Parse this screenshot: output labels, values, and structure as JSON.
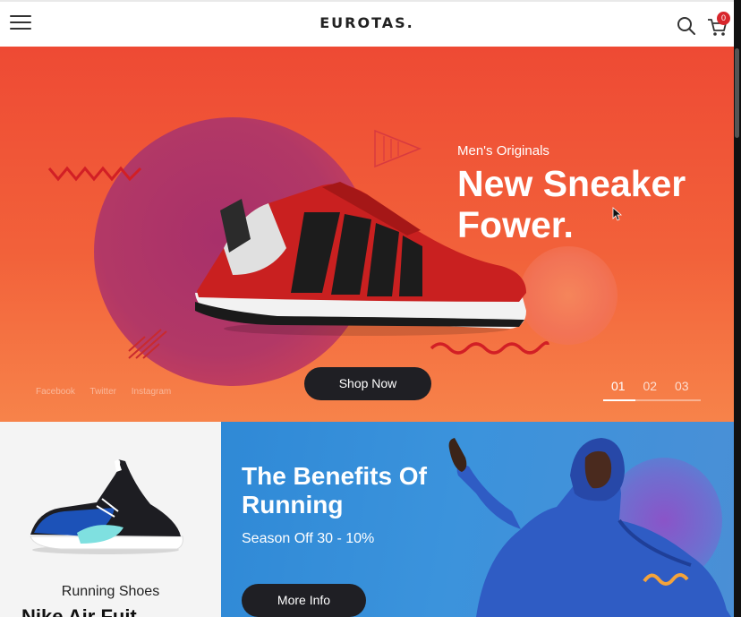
{
  "header": {
    "logo": "EUROTAS.",
    "cart_count": "0"
  },
  "hero": {
    "subtitle": "Men's Originals",
    "title": "New Sneaker Fower.",
    "shop_button": "Shop Now",
    "socials": [
      "Facebook",
      "Twitter",
      "Instagram"
    ],
    "slides": [
      "01",
      "02",
      "03"
    ],
    "active_slide": "01",
    "slide_progress": 0.33,
    "colors": {
      "accent": "#ee4a34",
      "button": "#1f1f24"
    }
  },
  "product_card": {
    "title": "Running Shoes",
    "subtitle": "Nike Air Fuit"
  },
  "promo": {
    "title": "The Benefits Of Running",
    "subtitle": "Season Off 30 - 10%",
    "button": "More Info"
  }
}
